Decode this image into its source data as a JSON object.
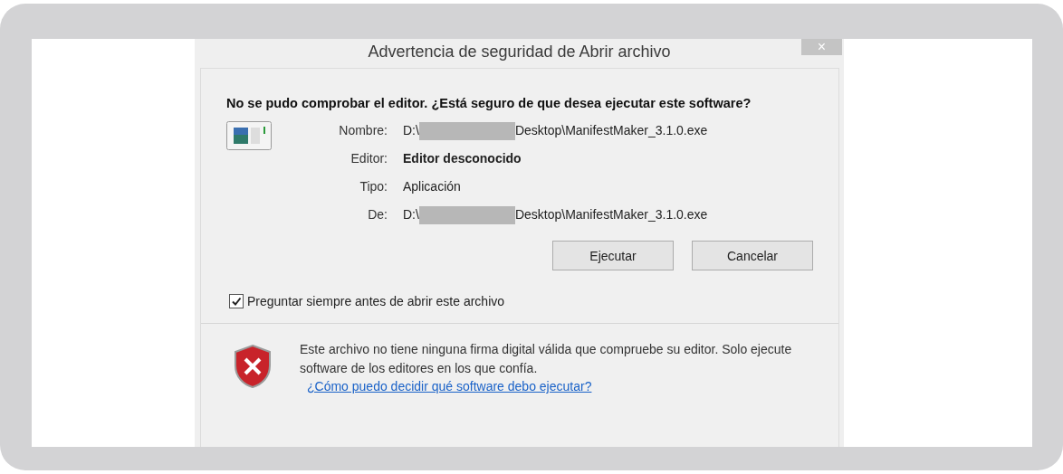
{
  "window": {
    "title": "Advertencia de seguridad de Abrir archivo",
    "close": "×"
  },
  "heading": "No se pudo comprobar el editor. ¿Está seguro de que desea ejecutar este software?",
  "fields": [
    {
      "kind": "redacted_path",
      "label": "Nombre:",
      "prefix": "D:\\",
      "suffix": "Desktop\\ManifestMaker_3.1.0.exe"
    },
    {
      "kind": "bold",
      "label": "Editor:",
      "value": "Editor desconocido"
    },
    {
      "kind": "plain",
      "label": "Tipo:",
      "value": "Aplicación"
    },
    {
      "kind": "redacted_path",
      "label": "De:",
      "prefix": "D:\\",
      "suffix": "Desktop\\ManifestMaker_3.1.0.exe"
    }
  ],
  "buttons": [
    "Ejecutar",
    "Cancelar"
  ],
  "checkbox": {
    "label": "Preguntar siempre antes de abrir este archivo",
    "checked": true
  },
  "footer": {
    "text": "Este archivo no tiene ninguna firma digital válida que compruebe su editor. Solo ejecute software de los editores en los que confía.",
    "link": "¿Cómo puedo decidir qué software debo ejecutar?"
  }
}
